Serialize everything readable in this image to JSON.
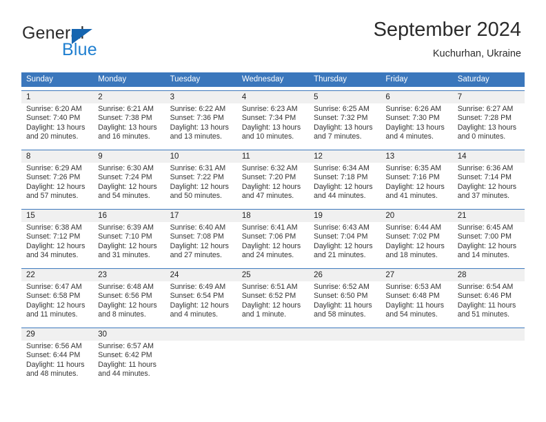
{
  "brand": {
    "name_top": "General",
    "name_bottom": "Blue",
    "accent_color": "#1f7fd0",
    "triangle_color": "#1565b0"
  },
  "header": {
    "title": "September 2024",
    "subtitle": "Kuchurhan, Ukraine"
  },
  "theme": {
    "header_row_bg": "#3b77bc",
    "header_row_text": "#ffffff",
    "daynum_band_bg": "#f0f0f0",
    "cell_bg": "#ffffff",
    "text_color": "#333333"
  },
  "weekdays": [
    "Sunday",
    "Monday",
    "Tuesday",
    "Wednesday",
    "Thursday",
    "Friday",
    "Saturday"
  ],
  "weeks": [
    [
      {
        "day": "1",
        "sunrise": "Sunrise: 6:20 AM",
        "sunset": "Sunset: 7:40 PM",
        "daylight1": "Daylight: 13 hours",
        "daylight2": "and 20 minutes."
      },
      {
        "day": "2",
        "sunrise": "Sunrise: 6:21 AM",
        "sunset": "Sunset: 7:38 PM",
        "daylight1": "Daylight: 13 hours",
        "daylight2": "and 16 minutes."
      },
      {
        "day": "3",
        "sunrise": "Sunrise: 6:22 AM",
        "sunset": "Sunset: 7:36 PM",
        "daylight1": "Daylight: 13 hours",
        "daylight2": "and 13 minutes."
      },
      {
        "day": "4",
        "sunrise": "Sunrise: 6:23 AM",
        "sunset": "Sunset: 7:34 PM",
        "daylight1": "Daylight: 13 hours",
        "daylight2": "and 10 minutes."
      },
      {
        "day": "5",
        "sunrise": "Sunrise: 6:25 AM",
        "sunset": "Sunset: 7:32 PM",
        "daylight1": "Daylight: 13 hours",
        "daylight2": "and 7 minutes."
      },
      {
        "day": "6",
        "sunrise": "Sunrise: 6:26 AM",
        "sunset": "Sunset: 7:30 PM",
        "daylight1": "Daylight: 13 hours",
        "daylight2": "and 4 minutes."
      },
      {
        "day": "7",
        "sunrise": "Sunrise: 6:27 AM",
        "sunset": "Sunset: 7:28 PM",
        "daylight1": "Daylight: 13 hours",
        "daylight2": "and 0 minutes."
      }
    ],
    [
      {
        "day": "8",
        "sunrise": "Sunrise: 6:29 AM",
        "sunset": "Sunset: 7:26 PM",
        "daylight1": "Daylight: 12 hours",
        "daylight2": "and 57 minutes."
      },
      {
        "day": "9",
        "sunrise": "Sunrise: 6:30 AM",
        "sunset": "Sunset: 7:24 PM",
        "daylight1": "Daylight: 12 hours",
        "daylight2": "and 54 minutes."
      },
      {
        "day": "10",
        "sunrise": "Sunrise: 6:31 AM",
        "sunset": "Sunset: 7:22 PM",
        "daylight1": "Daylight: 12 hours",
        "daylight2": "and 50 minutes."
      },
      {
        "day": "11",
        "sunrise": "Sunrise: 6:32 AM",
        "sunset": "Sunset: 7:20 PM",
        "daylight1": "Daylight: 12 hours",
        "daylight2": "and 47 minutes."
      },
      {
        "day": "12",
        "sunrise": "Sunrise: 6:34 AM",
        "sunset": "Sunset: 7:18 PM",
        "daylight1": "Daylight: 12 hours",
        "daylight2": "and 44 minutes."
      },
      {
        "day": "13",
        "sunrise": "Sunrise: 6:35 AM",
        "sunset": "Sunset: 7:16 PM",
        "daylight1": "Daylight: 12 hours",
        "daylight2": "and 41 minutes."
      },
      {
        "day": "14",
        "sunrise": "Sunrise: 6:36 AM",
        "sunset": "Sunset: 7:14 PM",
        "daylight1": "Daylight: 12 hours",
        "daylight2": "and 37 minutes."
      }
    ],
    [
      {
        "day": "15",
        "sunrise": "Sunrise: 6:38 AM",
        "sunset": "Sunset: 7:12 PM",
        "daylight1": "Daylight: 12 hours",
        "daylight2": "and 34 minutes."
      },
      {
        "day": "16",
        "sunrise": "Sunrise: 6:39 AM",
        "sunset": "Sunset: 7:10 PM",
        "daylight1": "Daylight: 12 hours",
        "daylight2": "and 31 minutes."
      },
      {
        "day": "17",
        "sunrise": "Sunrise: 6:40 AM",
        "sunset": "Sunset: 7:08 PM",
        "daylight1": "Daylight: 12 hours",
        "daylight2": "and 27 minutes."
      },
      {
        "day": "18",
        "sunrise": "Sunrise: 6:41 AM",
        "sunset": "Sunset: 7:06 PM",
        "daylight1": "Daylight: 12 hours",
        "daylight2": "and 24 minutes."
      },
      {
        "day": "19",
        "sunrise": "Sunrise: 6:43 AM",
        "sunset": "Sunset: 7:04 PM",
        "daylight1": "Daylight: 12 hours",
        "daylight2": "and 21 minutes."
      },
      {
        "day": "20",
        "sunrise": "Sunrise: 6:44 AM",
        "sunset": "Sunset: 7:02 PM",
        "daylight1": "Daylight: 12 hours",
        "daylight2": "and 18 minutes."
      },
      {
        "day": "21",
        "sunrise": "Sunrise: 6:45 AM",
        "sunset": "Sunset: 7:00 PM",
        "daylight1": "Daylight: 12 hours",
        "daylight2": "and 14 minutes."
      }
    ],
    [
      {
        "day": "22",
        "sunrise": "Sunrise: 6:47 AM",
        "sunset": "Sunset: 6:58 PM",
        "daylight1": "Daylight: 12 hours",
        "daylight2": "and 11 minutes."
      },
      {
        "day": "23",
        "sunrise": "Sunrise: 6:48 AM",
        "sunset": "Sunset: 6:56 PM",
        "daylight1": "Daylight: 12 hours",
        "daylight2": "and 8 minutes."
      },
      {
        "day": "24",
        "sunrise": "Sunrise: 6:49 AM",
        "sunset": "Sunset: 6:54 PM",
        "daylight1": "Daylight: 12 hours",
        "daylight2": "and 4 minutes."
      },
      {
        "day": "25",
        "sunrise": "Sunrise: 6:51 AM",
        "sunset": "Sunset: 6:52 PM",
        "daylight1": "Daylight: 12 hours",
        "daylight2": "and 1 minute."
      },
      {
        "day": "26",
        "sunrise": "Sunrise: 6:52 AM",
        "sunset": "Sunset: 6:50 PM",
        "daylight1": "Daylight: 11 hours",
        "daylight2": "and 58 minutes."
      },
      {
        "day": "27",
        "sunrise": "Sunrise: 6:53 AM",
        "sunset": "Sunset: 6:48 PM",
        "daylight1": "Daylight: 11 hours",
        "daylight2": "and 54 minutes."
      },
      {
        "day": "28",
        "sunrise": "Sunrise: 6:54 AM",
        "sunset": "Sunset: 6:46 PM",
        "daylight1": "Daylight: 11 hours",
        "daylight2": "and 51 minutes."
      }
    ],
    [
      {
        "day": "29",
        "sunrise": "Sunrise: 6:56 AM",
        "sunset": "Sunset: 6:44 PM",
        "daylight1": "Daylight: 11 hours",
        "daylight2": "and 48 minutes."
      },
      {
        "day": "30",
        "sunrise": "Sunrise: 6:57 AM",
        "sunset": "Sunset: 6:42 PM",
        "daylight1": "Daylight: 11 hours",
        "daylight2": "and 44 minutes."
      },
      {
        "day": "",
        "sunrise": "",
        "sunset": "",
        "daylight1": "",
        "daylight2": ""
      },
      {
        "day": "",
        "sunrise": "",
        "sunset": "",
        "daylight1": "",
        "daylight2": ""
      },
      {
        "day": "",
        "sunrise": "",
        "sunset": "",
        "daylight1": "",
        "daylight2": ""
      },
      {
        "day": "",
        "sunrise": "",
        "sunset": "",
        "daylight1": "",
        "daylight2": ""
      },
      {
        "day": "",
        "sunrise": "",
        "sunset": "",
        "daylight1": "",
        "daylight2": ""
      }
    ]
  ]
}
